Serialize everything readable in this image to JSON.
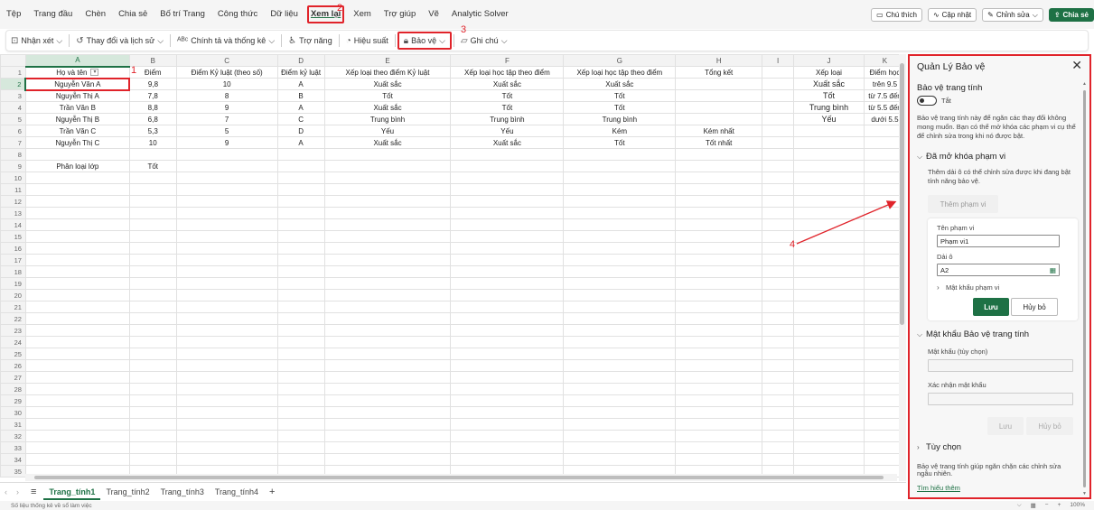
{
  "menu": {
    "tabs": [
      "Tệp",
      "Trang đầu",
      "Chèn",
      "Chia sẻ",
      "Bố trí Trang",
      "Công thức",
      "Dữ liệu",
      "Xem lại",
      "Xem",
      "Trợ giúp",
      "Vẽ",
      "Analytic Solver"
    ],
    "active_index": 7,
    "right": {
      "comments": "Chú thích",
      "catchup": "Cập nhật",
      "editing": "Chỉnh sửa",
      "share": "Chia sẻ"
    }
  },
  "toolbar": {
    "comments": "Nhận xét",
    "track_changes": "Thay đổi và lịch sử",
    "spelling": "Chính tả và thống kê",
    "accessibility": "Trợ năng",
    "performance": "Hiệu suất",
    "protect": "Bảo vệ",
    "notes": "Ghi chú"
  },
  "annotations": {
    "n1": "1",
    "n2": "2",
    "n3": "3",
    "n4": "4"
  },
  "grid": {
    "columns": [
      "A",
      "B",
      "C",
      "D",
      "E",
      "F",
      "G",
      "H",
      "I",
      "J",
      "K"
    ],
    "rows": [
      [
        "Họ và tên",
        "Điểm",
        "Điểm Kỷ luật (theo số)",
        "Điểm kỷ luật",
        "Xếp loại theo điểm Kỷ luật",
        "Xếp loại học tập theo điểm",
        "Xếp loại học tập theo điểm",
        "Tổng kết",
        "",
        "Xếp loại",
        "Điểm học"
      ],
      [
        "Nguyễn Văn A",
        "9,8",
        "10",
        "A",
        "Xuất sắc",
        "Xuất sắc",
        "Xuất sắc",
        "",
        "",
        "Xuất sắc",
        "trên 9.5"
      ],
      [
        "Nguyễn Thị A",
        "7,8",
        "8",
        "B",
        "Tốt",
        "Tốt",
        "Tốt",
        "",
        "",
        "Tốt",
        "từ 7.5 đến"
      ],
      [
        "Trần Văn B",
        "8,8",
        "9",
        "A",
        "Xuất sắc",
        "Tốt",
        "Tốt",
        "",
        "",
        "Trung bình",
        "từ 5.5 đến"
      ],
      [
        "Nguyễn Thị B",
        "6,8",
        "7",
        "C",
        "Trung bình",
        "Trung bình",
        "Trung bình",
        "",
        "",
        "Yếu",
        "dưới 5.5"
      ],
      [
        "Trần Văn C",
        "5,3",
        "5",
        "D",
        "Yếu",
        "Yếu",
        "Kém",
        "Kém nhất",
        "",
        "",
        ""
      ],
      [
        "Nguyễn Thị C",
        "10",
        "9",
        "A",
        "Xuất sắc",
        "Xuất sắc",
        "Tốt",
        "Tốt nhất",
        "",
        "",
        ""
      ],
      [
        "",
        "",
        "",
        "",
        "",
        "",
        "",
        "",
        "",
        "",
        ""
      ],
      [
        "Phân loại lớp",
        "Tốt",
        "",
        "",
        "",
        "",
        "",
        "",
        "",
        "",
        ""
      ]
    ],
    "total_rows": 35
  },
  "sheets": {
    "tabs": [
      "Trang_tính1",
      "Trang_tính2",
      "Trang_tính3",
      "Trang_tính4"
    ],
    "active_index": 0
  },
  "statusbar": {
    "left": "Số liệu thống kê về sổ làm việc",
    "zoom": "100%"
  },
  "pane": {
    "title": "Quản Lý Bảo vệ",
    "protect_sheet_heading": "Bảo vệ trang tính",
    "toggle_label": "Tắt",
    "protect_desc": "Bảo vệ trang tính này để ngăn các thay đổi không mong muốn. Bạn có thể mở khóa các phạm vi cụ thể để chỉnh sửa trong khi nó được bật.",
    "unlocked_heading": "Đã mở khóa phạm vi",
    "unlocked_desc": "Thêm dải ô có thể chỉnh sửa được khi đang bật tính năng bảo vệ.",
    "add_range": "Thêm phạm vi",
    "range_name_label": "Tên phạm vi",
    "range_name_value": "Phạm vi1",
    "cells_label": "Dải ô",
    "cells_value": "A2",
    "range_password": "Mật khẩu phạm vi",
    "save": "Lưu",
    "cancel": "Hủy bỏ",
    "sheet_password_heading": "Mật khẩu Bảo vệ trang tính",
    "password_label": "Mật khẩu (tùy chọn)",
    "confirm_label": "Xác nhận mật khẩu",
    "save2": "Lưu",
    "cancel2": "Hủy bỏ",
    "options": "Tùy chọn",
    "footer_desc": "Bảo vệ trang tính giúp ngăn chặn các chỉnh sửa ngẫu nhiên.",
    "learn_more": "Tìm hiểu thêm"
  },
  "colors": {
    "accent": "#1e7145",
    "highlight": "#e0232a"
  }
}
